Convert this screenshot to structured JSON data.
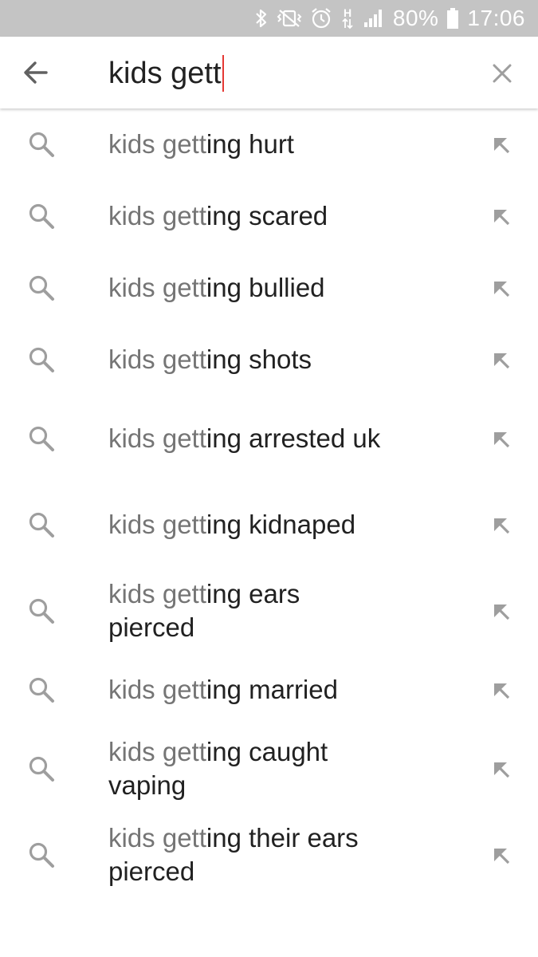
{
  "status_bar": {
    "battery": "80%",
    "time": "17:06",
    "network": "H",
    "icons": [
      "bluetooth-icon",
      "vibrate-mute-icon",
      "alarm-icon",
      "data-activity-icon",
      "signal-icon",
      "battery-icon"
    ]
  },
  "search": {
    "query": "kids gett",
    "back_icon": "arrow-left-icon",
    "clear_icon": "close-icon"
  },
  "suggestions": [
    {
      "typed": "kids gett",
      "rest": "ing hurt"
    },
    {
      "typed": "kids gett",
      "rest": "ing scared"
    },
    {
      "typed": "kids gett",
      "rest": "ing bullied"
    },
    {
      "typed": "kids gett",
      "rest": "ing shots"
    },
    {
      "typed": "kids gett",
      "rest": "ing arrested uk"
    },
    {
      "typed": "kids gett",
      "rest": "ing kidnaped"
    },
    {
      "typed": "kids gett",
      "rest": "ing ears pierced"
    },
    {
      "typed": "kids gett",
      "rest": "ing married"
    },
    {
      "typed": "kids gett",
      "rest": "ing caught vaping"
    },
    {
      "typed": "kids gett",
      "rest": "ing their ears pierced"
    }
  ],
  "colors": {
    "status_bar_bg": "#c4c4c4",
    "cursor": "#e53935",
    "typed_text": "#757575",
    "suggested_text": "#212121",
    "icon": "#9e9e9e"
  }
}
